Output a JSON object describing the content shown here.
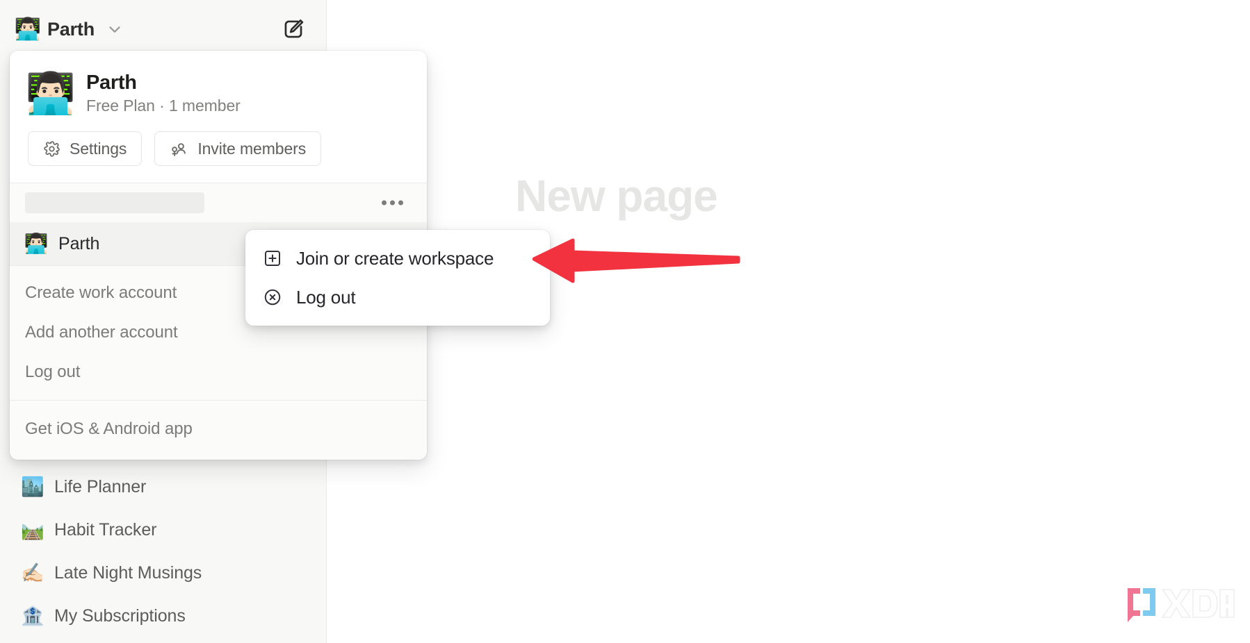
{
  "sidebar": {
    "header": {
      "avatar_emoji": "👨🏻‍💻",
      "workspace_name": "Parth",
      "chevron_icon": "chevron-down-icon",
      "compose_icon": "compose-icon"
    },
    "pages": [
      {
        "emoji": "🏙️",
        "label": "Life Planner"
      },
      {
        "emoji": "🛤️",
        "label": "Habit Tracker"
      },
      {
        "emoji": "✍🏻",
        "label": "Late Night Musings"
      },
      {
        "emoji": "🏦",
        "label": "My Subscriptions"
      }
    ]
  },
  "main": {
    "page_title_placeholder": "New page"
  },
  "popover": {
    "account": {
      "avatar_emoji": "👨🏻‍💻",
      "name": "Parth",
      "meta": "Free Plan · 1 member"
    },
    "buttons": [
      {
        "icon": "gear-icon",
        "label": "Settings"
      },
      {
        "icon": "invite-members-icon",
        "label": "Invite members"
      }
    ],
    "loading_placeholder": {
      "is_skeleton": true,
      "more_icon": "more-horizontal-icon"
    },
    "workspace_row": {
      "emoji": "👨🏻‍💻",
      "label": "Parth",
      "selected": true
    },
    "account_actions": [
      {
        "label": "Create work account"
      },
      {
        "label": "Add another account"
      },
      {
        "label": "Log out"
      }
    ],
    "footer_actions": [
      {
        "label": "Get iOS & Android app"
      }
    ]
  },
  "context_menu": {
    "items": [
      {
        "icon": "square-plus-icon",
        "label": "Join or create workspace"
      },
      {
        "icon": "circle-x-icon",
        "label": "Log out"
      }
    ]
  },
  "annotation": {
    "arrow": {
      "name": "red-pointer-arrow",
      "color": "#F2323F",
      "direction": "left"
    }
  },
  "watermark": {
    "text": "XDA",
    "bracket_left_color": "#F06D8E",
    "bracket_right_color": "#79C8EF"
  },
  "colors": {
    "sidebar_bg": "#F8F8F7",
    "popover_bg": "#FBFBFA",
    "menu_bg": "#FFFFFF",
    "text_primary": "#1F1F1E",
    "text_secondary": "#7B7B78",
    "placeholder_text": "#E6E6E5",
    "accent_red": "#F2323F"
  }
}
